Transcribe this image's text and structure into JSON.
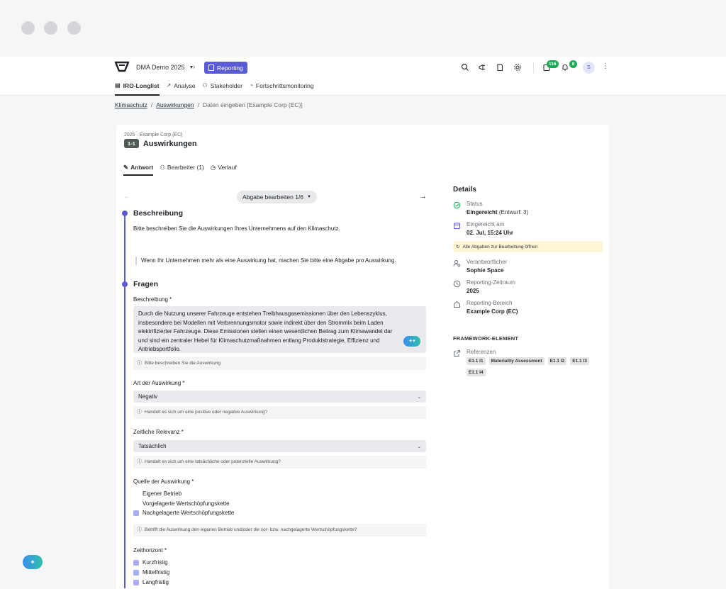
{
  "nav": {
    "project": "DMA Demo 2025",
    "module": "Reporting",
    "tabs": [
      {
        "label": "IRO-Longlist",
        "icon": "list-icon"
      },
      {
        "label": "Analyse",
        "icon": "chart-icon"
      },
      {
        "label": "Stakeholder",
        "icon": "people-icon"
      },
      {
        "label": "Fortschrittsmonitoring",
        "icon": "gauge-icon"
      }
    ],
    "tasks_count": "116",
    "notifications_count": "8",
    "avatar_initial": "S"
  },
  "breadcrumb": {
    "items": [
      "Klimaschutz",
      "Auswirkungen"
    ],
    "current": "Daten eingeben [Example Corp (EC)]"
  },
  "card": {
    "subtitle": "2025 · Example Corp (EC)",
    "id": "1-1",
    "title": "Auswirkungen",
    "tabs": [
      "Antwort",
      "Bearbeiter (1)",
      "Verlauf"
    ],
    "submission_label": "Abgabe bearbeiten 1/6"
  },
  "description": {
    "heading": "Beschreibung",
    "text": "Bitte beschreiben Sie die Auswirkungen Ihres Unternehmens auf den Klimaschutz.",
    "quote": "Wenn Ihr Unternehmen mehr als eine Auswirkung hat, machen Sie bitte eine Abgabe pro Auswirkung."
  },
  "questions": {
    "heading": "Fragen",
    "beschreibung": {
      "label": "Beschreibung *",
      "lines": [
        "Durch die Nutzung unserer Fahrzeuge entstehen Treibhausgasemissionen über den Lebenszyklus,",
        "insbesondere bei Modellen mit Verbrennungsmotor sowie indirekt über den Strommix beim Laden",
        "elektrifizierter Fahrzeuge. Diese Emissionen stellen einen wesentlichen Beitrag zum Klimawandel dar",
        "und sind ein zentraler Hebel für Klimaschutzmaßnahmen entlang Produktstrategie, Effizienz und",
        "Antriebsportfolio."
      ],
      "hint": "Bitte beschreiben Sie die Auswirkung"
    },
    "art": {
      "label": "Art der Auswirkung *",
      "value": "Negativ",
      "hint": "Handelt es sich um eine positive oder negative Auswirkung?"
    },
    "zeitlich": {
      "label": "Zeitliche Relevanz *",
      "value": "Tatsächlich",
      "hint": "Handelt es sich um eine tatsächliche oder potenzielle Auswirkung?"
    },
    "quelle": {
      "label": "Quelle der Auswirkung  *",
      "options": [
        {
          "label": "Eigener Betrieb",
          "checked": false
        },
        {
          "label": "Vorgelagerte Wertschöpfungskette",
          "checked": false
        },
        {
          "label": "Nachgelagerte Wertschöpfungskette",
          "checked": true
        }
      ],
      "hint": "Betrifft die Auswirkung den eigenen Betrieb und/oder die vor- bzw. nachgelagerte Wertschöpfungskette?"
    },
    "zeithorizont": {
      "label": "Zeithorizont *",
      "options": [
        {
          "label": "Kurzfristig",
          "checked": true
        },
        {
          "label": "Mittelfristig",
          "checked": true
        },
        {
          "label": "Langfristig",
          "checked": true
        }
      ]
    }
  },
  "details": {
    "heading": "Details",
    "status_label": "Status",
    "status_value": "Eingereicht",
    "status_draft": "(Entwurf: 3)",
    "submitted_label": "Eingereicht am",
    "submitted_value": "02. Jul, 15:24 Uhr",
    "open_all": "Alle Abgaben zur Bearbeitung öffnen",
    "owner_label": "Verantwortlicher",
    "owner_value": "Sophie Space",
    "period_label": "Reporting-Zeitraum",
    "period_value": "2025",
    "scope_label": "Reporting-Bereich",
    "scope_value": "Example Corp (EC)",
    "framework_heading": "FRAMEWORK-ELEMENT",
    "references_label": "Referenzen",
    "references": [
      "E1.1 I1",
      "Materiality Assessment",
      "E1.1 I2",
      "E1.1 I3",
      "E1.1 I4"
    ]
  },
  "colors": {
    "accent": "#5b5bd6",
    "success": "#1aaa55",
    "banner": "#fdf5d6"
  }
}
